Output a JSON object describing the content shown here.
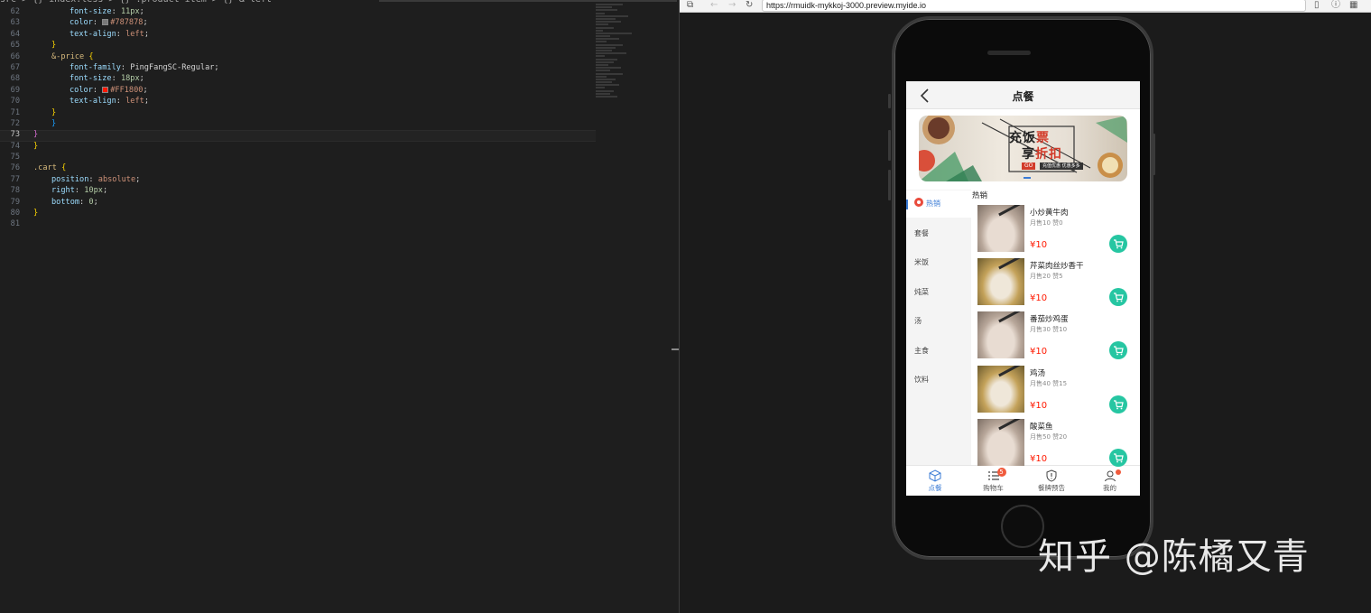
{
  "editor": {
    "breadcrumb": [
      "src",
      ">",
      "{} index.less",
      ">",
      "{} .product-item",
      ">",
      "{} &-left"
    ],
    "lines": [
      {
        "num": "62",
        "parts": [
          [
            "p",
            "font-size"
          ],
          [
            "t",
            ": "
          ],
          [
            "n",
            "11px"
          ],
          [
            "t",
            ";"
          ]
        ],
        "indent": 2
      },
      {
        "num": "63",
        "parts": [
          [
            "p",
            "color"
          ],
          [
            "t",
            ": "
          ],
          [
            "sw",
            "#787878"
          ],
          [
            "v",
            "#787878"
          ],
          [
            "t",
            ";"
          ]
        ],
        "indent": 2
      },
      {
        "num": "64",
        "parts": [
          [
            "p",
            "text-align"
          ],
          [
            "t",
            ": "
          ],
          [
            "v",
            "left"
          ],
          [
            "t",
            ";"
          ]
        ],
        "indent": 2
      },
      {
        "num": "65",
        "parts": [
          [
            "b1",
            "}"
          ]
        ],
        "indent": 1
      },
      {
        "num": "66",
        "parts": [
          [
            "s",
            "&-price"
          ],
          [
            "t",
            " "
          ],
          [
            "b1",
            "{"
          ]
        ],
        "indent": 1
      },
      {
        "num": "67",
        "parts": [
          [
            "p",
            "font-family"
          ],
          [
            "t",
            ": "
          ],
          [
            "t",
            "PingFangSC-Regular"
          ],
          [
            "t",
            ";"
          ]
        ],
        "indent": 2
      },
      {
        "num": "68",
        "parts": [
          [
            "p",
            "font-size"
          ],
          [
            "t",
            ": "
          ],
          [
            "n",
            "18px"
          ],
          [
            "t",
            ";"
          ]
        ],
        "indent": 2
      },
      {
        "num": "69",
        "parts": [
          [
            "p",
            "color"
          ],
          [
            "t",
            ": "
          ],
          [
            "sw",
            "#FF1800"
          ],
          [
            "v",
            "#FF1800"
          ],
          [
            "t",
            ";"
          ]
        ],
        "indent": 2
      },
      {
        "num": "70",
        "parts": [
          [
            "p",
            "text-align"
          ],
          [
            "t",
            ": "
          ],
          [
            "v",
            "left"
          ],
          [
            "t",
            ";"
          ]
        ],
        "indent": 2
      },
      {
        "num": "71",
        "parts": [
          [
            "b1",
            "}"
          ]
        ],
        "indent": 1
      },
      {
        "num": "72",
        "parts": [
          [
            "b3",
            "}"
          ]
        ],
        "indent": 1
      },
      {
        "num": "73",
        "parts": [
          [
            "b2",
            "}"
          ]
        ],
        "indent": 0,
        "active": true
      },
      {
        "num": "74",
        "parts": [
          [
            "b1",
            "}"
          ]
        ],
        "indent": 0
      },
      {
        "num": "75",
        "parts": [],
        "indent": 0
      },
      {
        "num": "76",
        "parts": [
          [
            "s",
            ".cart"
          ],
          [
            "t",
            " "
          ],
          [
            "b1",
            "{"
          ]
        ],
        "indent": 0
      },
      {
        "num": "77",
        "parts": [
          [
            "p",
            "position"
          ],
          [
            "t",
            ": "
          ],
          [
            "v",
            "absolute"
          ],
          [
            "t",
            ";"
          ]
        ],
        "indent": 1
      },
      {
        "num": "78",
        "parts": [
          [
            "p",
            "right"
          ],
          [
            "t",
            ": "
          ],
          [
            "n",
            "10px"
          ],
          [
            "t",
            ";"
          ]
        ],
        "indent": 1
      },
      {
        "num": "79",
        "parts": [
          [
            "p",
            "bottom"
          ],
          [
            "t",
            ": "
          ],
          [
            "n",
            "0"
          ],
          [
            "t",
            ";"
          ]
        ],
        "indent": 1
      },
      {
        "num": "80",
        "parts": [
          [
            "b1",
            "}"
          ]
        ],
        "indent": 0
      },
      {
        "num": "81",
        "parts": [],
        "indent": 0
      }
    ]
  },
  "browser": {
    "url": "https://rmuidk-mykkoj-3000.preview.myide.io"
  },
  "app": {
    "title": "点餐",
    "banner": {
      "line1a": "充饭",
      "line1b": "票",
      "line2a": "享",
      "line2b": "折扣",
      "tag": "GO",
      "note": "充值优惠 优惠多多"
    },
    "menu": [
      {
        "label": "热销",
        "active": true
      },
      {
        "label": "套餐"
      },
      {
        "label": "米饭"
      },
      {
        "label": "炖菜"
      },
      {
        "label": "汤"
      },
      {
        "label": "主食"
      },
      {
        "label": "饮料"
      }
    ],
    "section_title": "热销",
    "products": [
      {
        "name": "小炒黄牛肉",
        "stats": "月售10 赞0",
        "price": "¥10",
        "img": "a"
      },
      {
        "name": "芹菜肉丝炒香干",
        "stats": "月售20 赞5",
        "price": "¥10",
        "img": "b"
      },
      {
        "name": "番茄炒鸡蛋",
        "stats": "月售30 赞10",
        "price": "¥10",
        "img": "a"
      },
      {
        "name": "鸡汤",
        "stats": "月售40 赞15",
        "price": "¥10",
        "img": "b"
      },
      {
        "name": "酸菜鱼",
        "stats": "月售50 赞20",
        "price": "¥10",
        "img": "a"
      }
    ],
    "tabs": [
      {
        "label": "点餐",
        "icon": "cube-icon",
        "active": true
      },
      {
        "label": "购物车",
        "icon": "list-icon",
        "badge": "5"
      },
      {
        "label": "餐牌预告",
        "icon": "shield-alert-icon"
      },
      {
        "label": "我的",
        "icon": "user-icon",
        "dot": true
      }
    ],
    "colors": {
      "accent": "#3a7bd5",
      "price": "#ff1800",
      "cart": "#26c6a2",
      "badge": "#f05a3c"
    }
  },
  "watermark": "知乎 @陈橘又青"
}
